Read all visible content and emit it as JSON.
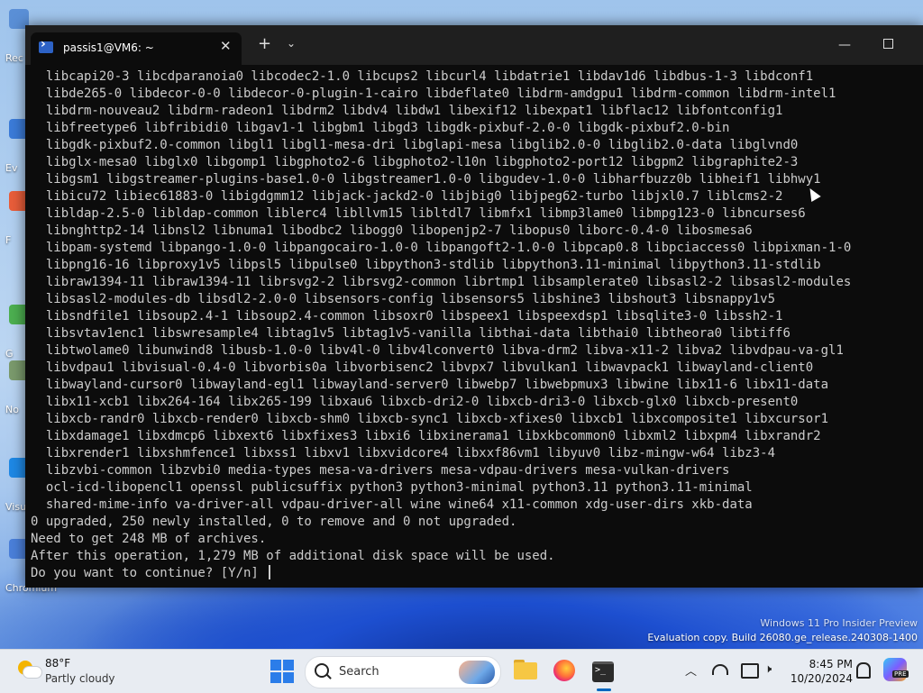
{
  "desktop": {
    "icons": [
      {
        "label": "Rec",
        "icon": "recycle-bin-icon",
        "color": "#5a8fd6"
      },
      {
        "label": "Ev",
        "icon": "app-icon",
        "color": "#3b7bd8"
      },
      {
        "label": "F",
        "icon": "app-icon",
        "color": "#e85d3a"
      },
      {
        "label": "G",
        "icon": "app-icon",
        "color": "#4caf50"
      },
      {
        "label": "No",
        "icon": "app-icon",
        "color": "#7a9a6c"
      },
      {
        "label": "Visu",
        "icon": "vscode-icon",
        "color": "#1e88e5"
      },
      {
        "label": "Chromium",
        "icon": "chromium-icon",
        "color": "#4a7fd9"
      }
    ],
    "watermark": {
      "line1": "Windows 11 Pro Insider Preview",
      "line2": "Evaluation copy. Build 26080.ge_release.240308-1400"
    }
  },
  "terminal": {
    "tab_title": "passis1@VM6: ~",
    "lines": [
      "  libcapi20-3 libcdparanoia0 libcodec2-1.0 libcups2 libcurl4 libdatrie1 libdav1d6 libdbus-1-3 libdconf1",
      "  libde265-0 libdecor-0-0 libdecor-0-plugin-1-cairo libdeflate0 libdrm-amdgpu1 libdrm-common libdrm-intel1",
      "  libdrm-nouveau2 libdrm-radeon1 libdrm2 libdv4 libdw1 libexif12 libexpat1 libflac12 libfontconfig1",
      "  libfreetype6 libfribidi0 libgav1-1 libgbm1 libgd3 libgdk-pixbuf-2.0-0 libgdk-pixbuf2.0-bin",
      "  libgdk-pixbuf2.0-common libgl1 libgl1-mesa-dri libglapi-mesa libglib2.0-0 libglib2.0-data libglvnd0",
      "  libglx-mesa0 libglx0 libgomp1 libgphoto2-6 libgphoto2-l10n libgphoto2-port12 libgpm2 libgraphite2-3",
      "  libgsm1 libgstreamer-plugins-base1.0-0 libgstreamer1.0-0 libgudev-1.0-0 libharfbuzz0b libheif1 libhwy1",
      "  libicu72 libiec61883-0 libigdgmm12 libjack-jackd2-0 libjbig0 libjpeg62-turbo libjxl0.7 liblcms2-2",
      "  libldap-2.5-0 libldap-common liblerc4 libllvm15 libltdl7 libmfx1 libmp3lame0 libmpg123-0 libncurses6",
      "  libnghttp2-14 libnsl2 libnuma1 libodbc2 libogg0 libopenjp2-7 libopus0 liborc-0.4-0 libosmesa6",
      "  libpam-systemd libpango-1.0-0 libpangocairo-1.0-0 libpangoft2-1.0-0 libpcap0.8 libpciaccess0 libpixman-1-0",
      "  libpng16-16 libproxy1v5 libpsl5 libpulse0 libpython3-stdlib libpython3.11-minimal libpython3.11-stdlib",
      "  libraw1394-11 libraw1394-11 librsvg2-2 librsvg2-common librtmp1 libsamplerate0 libsasl2-2 libsasl2-modules",
      "  libsasl2-modules-db libsdl2-2.0-0 libsensors-config libsensors5 libshine3 libshout3 libsnappy1v5",
      "  libsndfile1 libsoup2.4-1 libsoup2.4-common libsoxr0 libspeex1 libspeexdsp1 libsqlite3-0 libssh2-1",
      "  libsvtav1enc1 libswresample4 libtag1v5 libtag1v5-vanilla libthai-data libthai0 libtheora0 libtiff6",
      "  libtwolame0 libunwind8 libusb-1.0-0 libv4l-0 libv4lconvert0 libva-drm2 libva-x11-2 libva2 libvdpau-va-gl1",
      "  libvdpau1 libvisual-0.4-0 libvorbis0a libvorbisenc2 libvpx7 libvulkan1 libwavpack1 libwayland-client0",
      "  libwayland-cursor0 libwayland-egl1 libwayland-server0 libwebp7 libwebpmux3 libwine libx11-6 libx11-data",
      "  libx11-xcb1 libx264-164 libx265-199 libxau6 libxcb-dri2-0 libxcb-dri3-0 libxcb-glx0 libxcb-present0",
      "  libxcb-randr0 libxcb-render0 libxcb-shm0 libxcb-sync1 libxcb-xfixes0 libxcb1 libxcomposite1 libxcursor1",
      "  libxdamage1 libxdmcp6 libxext6 libxfixes3 libxi6 libxinerama1 libxkbcommon0 libxml2 libxpm4 libxrandr2",
      "  libxrender1 libxshmfence1 libxss1 libxv1 libxvidcore4 libxxf86vm1 libyuv0 libz-mingw-w64 libz3-4",
      "  libzvbi-common libzvbi0 media-types mesa-va-drivers mesa-vdpau-drivers mesa-vulkan-drivers",
      "  ocl-icd-libopencl1 openssl publicsuffix python3 python3-minimal python3.11 python3.11-minimal",
      "  shared-mime-info va-driver-all vdpau-driver-all wine wine64 x11-common xdg-user-dirs xkb-data",
      "0 upgraded, 250 newly installed, 0 to remove and 0 not upgraded.",
      "Need to get 248 MB of archives.",
      "After this operation, 1,279 MB of additional disk space will be used."
    ],
    "prompt": "Do you want to continue? [Y/n] ",
    "colors": {
      "background": "#0c0c0c",
      "text": "#cccccc",
      "titlebar": "#1f1f1f"
    }
  },
  "taskbar": {
    "weather": {
      "temp": "88°F",
      "desc": "Partly cloudy"
    },
    "search_placeholder": "Search",
    "clock": {
      "time": "8:45 PM",
      "date": "10/20/2024"
    },
    "copilot_badge": "PRE"
  }
}
